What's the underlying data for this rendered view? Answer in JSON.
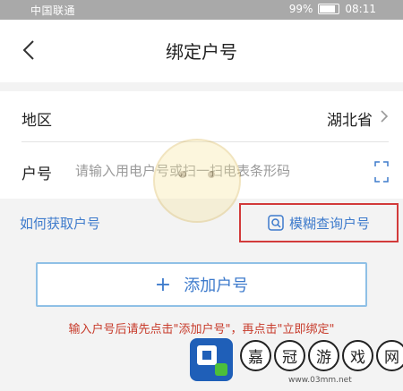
{
  "status_bar": {
    "carrier": "中国联通",
    "battery": "99%",
    "time": "08:11"
  },
  "header": {
    "title": "绑定户号"
  },
  "form": {
    "region_label": "地区",
    "region_value": "湖北省",
    "account_label": "户号",
    "account_placeholder": "请输入用电户号或扫一扫电表条形码",
    "account_value": ""
  },
  "links": {
    "how_to_get": "如何获取户号",
    "fuzzy_search": "模糊查询户号"
  },
  "add_button": {
    "label": "添加户号"
  },
  "hint": "输入户号后请先点击\"添加户号\"，再点击\"立即绑定\"",
  "watermark": {
    "chars": [
      "嘉",
      "冠",
      "游",
      "戏",
      "网"
    ],
    "url": "www.03mm.net"
  },
  "colors": {
    "accent": "#3e7bcc",
    "highlight_box": "#d23a3a",
    "hint": "#c73a2a"
  },
  "icons": [
    "back-arrow-icon",
    "chevron-right-icon",
    "scan-icon",
    "search-icon",
    "plus-icon",
    "site-logo"
  ]
}
